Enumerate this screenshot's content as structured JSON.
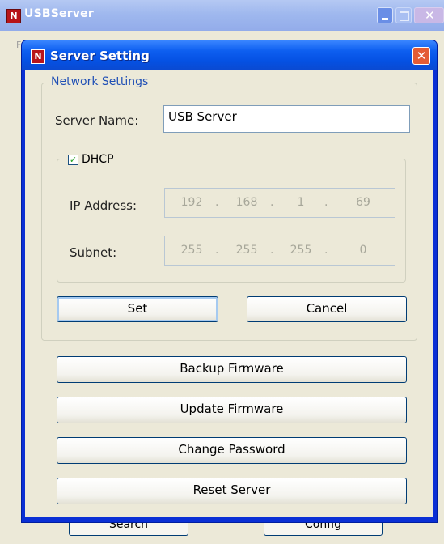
{
  "parent_window": {
    "title": "USBServer",
    "app_icon": "N",
    "menu_letter": "F",
    "search_button": "Search",
    "config_button": "Config"
  },
  "dialog": {
    "title": "Server Setting",
    "icon": "N",
    "close_glyph": "✕",
    "network_group": {
      "legend": "Network Settings",
      "server_name_label": "Server Name:",
      "server_name_value": "USB Server"
    },
    "dhcp": {
      "label": "DHCP",
      "checked": true,
      "check_glyph": "✓",
      "ip_label": "IP Address:",
      "ip_octets": [
        "192",
        "168",
        "1",
        "69"
      ],
      "subnet_label": "Subnet:",
      "subnet_octets": [
        "255",
        "255",
        "255",
        "0"
      ],
      "separator": "."
    },
    "buttons": {
      "set": "Set",
      "cancel": "Cancel",
      "backup": "Backup Firmware",
      "update": "Update Firmware",
      "password": "Change Password",
      "reset": "Reset Server"
    }
  }
}
